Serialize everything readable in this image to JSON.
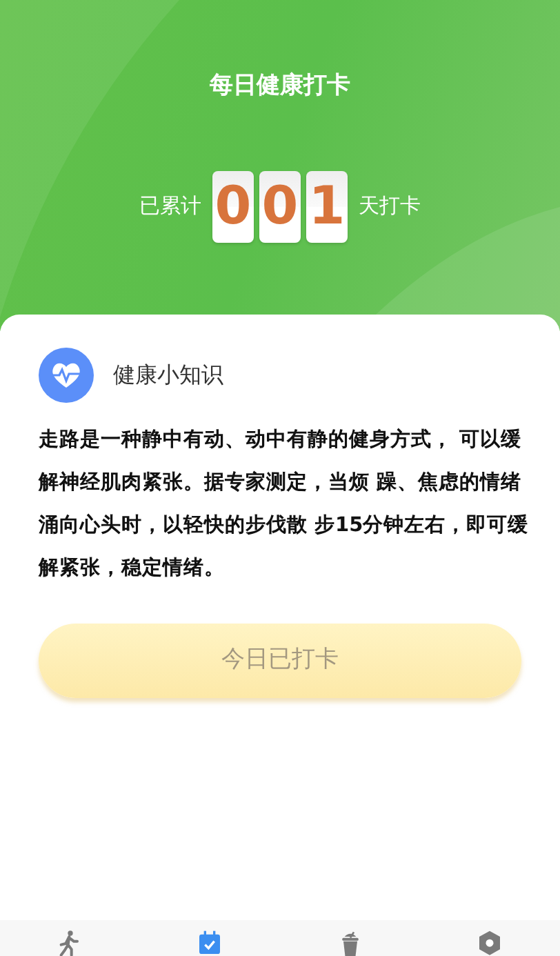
{
  "title": "每日健康打卡",
  "counter": {
    "prefix": "已累计",
    "digits": [
      "0",
      "0",
      "1"
    ],
    "suffix": "天打卡"
  },
  "tip": {
    "title": "健康小知识",
    "body": "走路是一种静中有动、动中有静的健身方式， 可以缓解神经肌肉紧张。据专家测定，当烦 躁、焦虑的情绪涌向心头时，以轻快的步伐散 步15分钟左右，即可缓解紧张，稳定情绪。"
  },
  "checkin_button": {
    "label": "今日已打卡",
    "disabled": true
  },
  "tabs": [
    {
      "kind": "walk",
      "selected": false
    },
    {
      "kind": "calendar",
      "selected": true
    },
    {
      "kind": "cup",
      "selected": false
    },
    {
      "kind": "settings",
      "selected": false
    }
  ]
}
